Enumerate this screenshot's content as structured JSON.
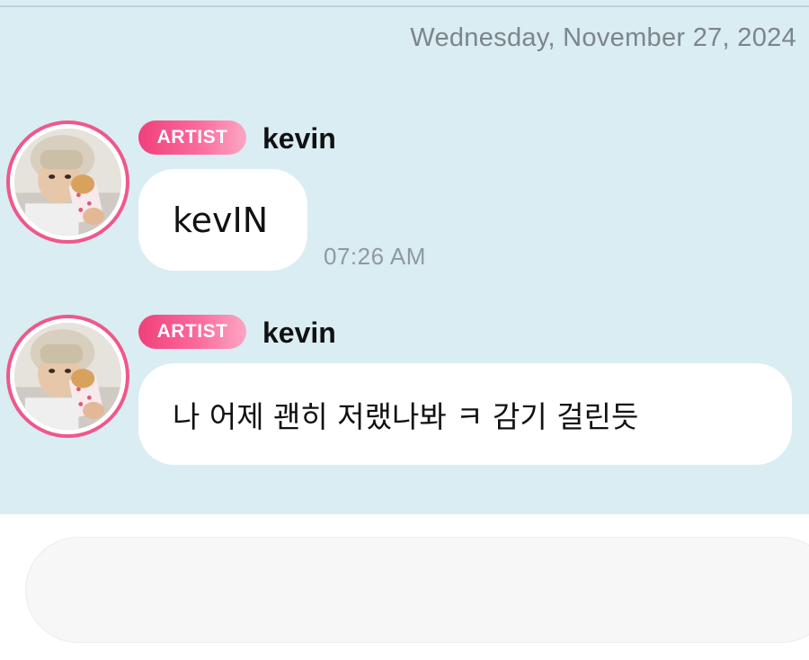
{
  "date_header": "Wednesday, November 27, 2024",
  "messages": [
    {
      "badge": "ARTIST",
      "sender": "kevin",
      "text": "kevIN",
      "time": "07:26 AM"
    },
    {
      "badge": "ARTIST",
      "sender": "kevin",
      "text": "나 어제 괜히 저랬나봐 ㅋ 감기 걸린듯",
      "time": ""
    }
  ],
  "input": {
    "placeholder": ""
  },
  "colors": {
    "chat_background": "#d9edf3",
    "badge_gradient_start": "#f0407a",
    "badge_gradient_end": "#fca6c4",
    "avatar_ring": "#f0578a"
  }
}
